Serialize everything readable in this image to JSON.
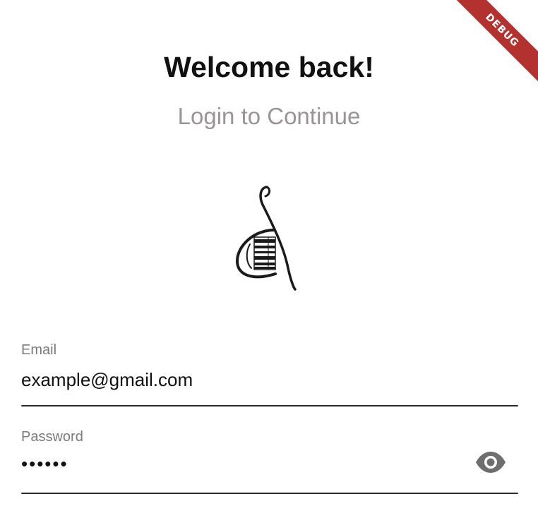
{
  "debug_banner": {
    "label": "DEBUG",
    "color": "#b3322f"
  },
  "header": {
    "title": "Welcome back!",
    "subtitle": "Login to Continue"
  },
  "logo": {
    "icon": "treble-clef-piano-icon"
  },
  "form": {
    "email": {
      "label": "Email",
      "value": "example@gmail.com"
    },
    "password": {
      "label": "Password",
      "value": "••••••",
      "toggle_icon": "eye-icon"
    }
  },
  "colors": {
    "title": "#111111",
    "subtitle": "#9a9397",
    "label": "#7a7a7a",
    "underline": "#2b2b2b",
    "icon": "#6e6e6e"
  }
}
